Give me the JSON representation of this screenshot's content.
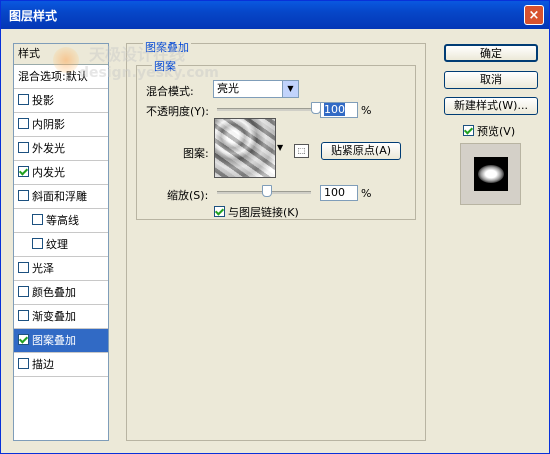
{
  "window": {
    "title": "图层样式",
    "close_glyph": "×"
  },
  "sidebar": {
    "header": "样式",
    "blend_options": "混合选项:默认",
    "items": [
      {
        "label": "投影",
        "checked": false,
        "sub": false
      },
      {
        "label": "内阴影",
        "checked": false,
        "sub": false
      },
      {
        "label": "外发光",
        "checked": false,
        "sub": false
      },
      {
        "label": "内发光",
        "checked": true,
        "sub": false
      },
      {
        "label": "斜面和浮雕",
        "checked": false,
        "sub": false
      },
      {
        "label": "等高线",
        "checked": false,
        "sub": true
      },
      {
        "label": "纹理",
        "checked": false,
        "sub": true
      },
      {
        "label": "光泽",
        "checked": false,
        "sub": false
      },
      {
        "label": "颜色叠加",
        "checked": false,
        "sub": false
      },
      {
        "label": "渐变叠加",
        "checked": false,
        "sub": false
      },
      {
        "label": "图案叠加",
        "checked": true,
        "sub": false,
        "selected": true
      },
      {
        "label": "描边",
        "checked": false,
        "sub": false
      }
    ]
  },
  "pattern_overlay": {
    "group_title": "图案叠加",
    "sub_group_title": "图案",
    "blend_mode_label": "混合模式:",
    "blend_mode_value": "亮光",
    "opacity_label": "不透明度(Y):",
    "opacity_value": "100",
    "opacity_level": 1.0,
    "percent_sign": "%",
    "pattern_label": "图案:",
    "snap_origin_button": "贴紧原点(A)",
    "scale_label": "缩放(S):",
    "scale_value": "100",
    "scale_level": 0.5,
    "link_layer_label": "与图层链接(K)",
    "link_layer_checked": true
  },
  "buttons": {
    "ok": "确定",
    "cancel": "取消",
    "new_style": "新建样式(W)..."
  },
  "preview": {
    "label": "预览(V)",
    "checked": true
  },
  "watermark": {
    "line1": "天极设计在线",
    "line2": "design.yesky.com"
  },
  "colors": {
    "titlebar": "#0a58e0",
    "selection": "#316ac5",
    "group_title": "#0046d5"
  }
}
